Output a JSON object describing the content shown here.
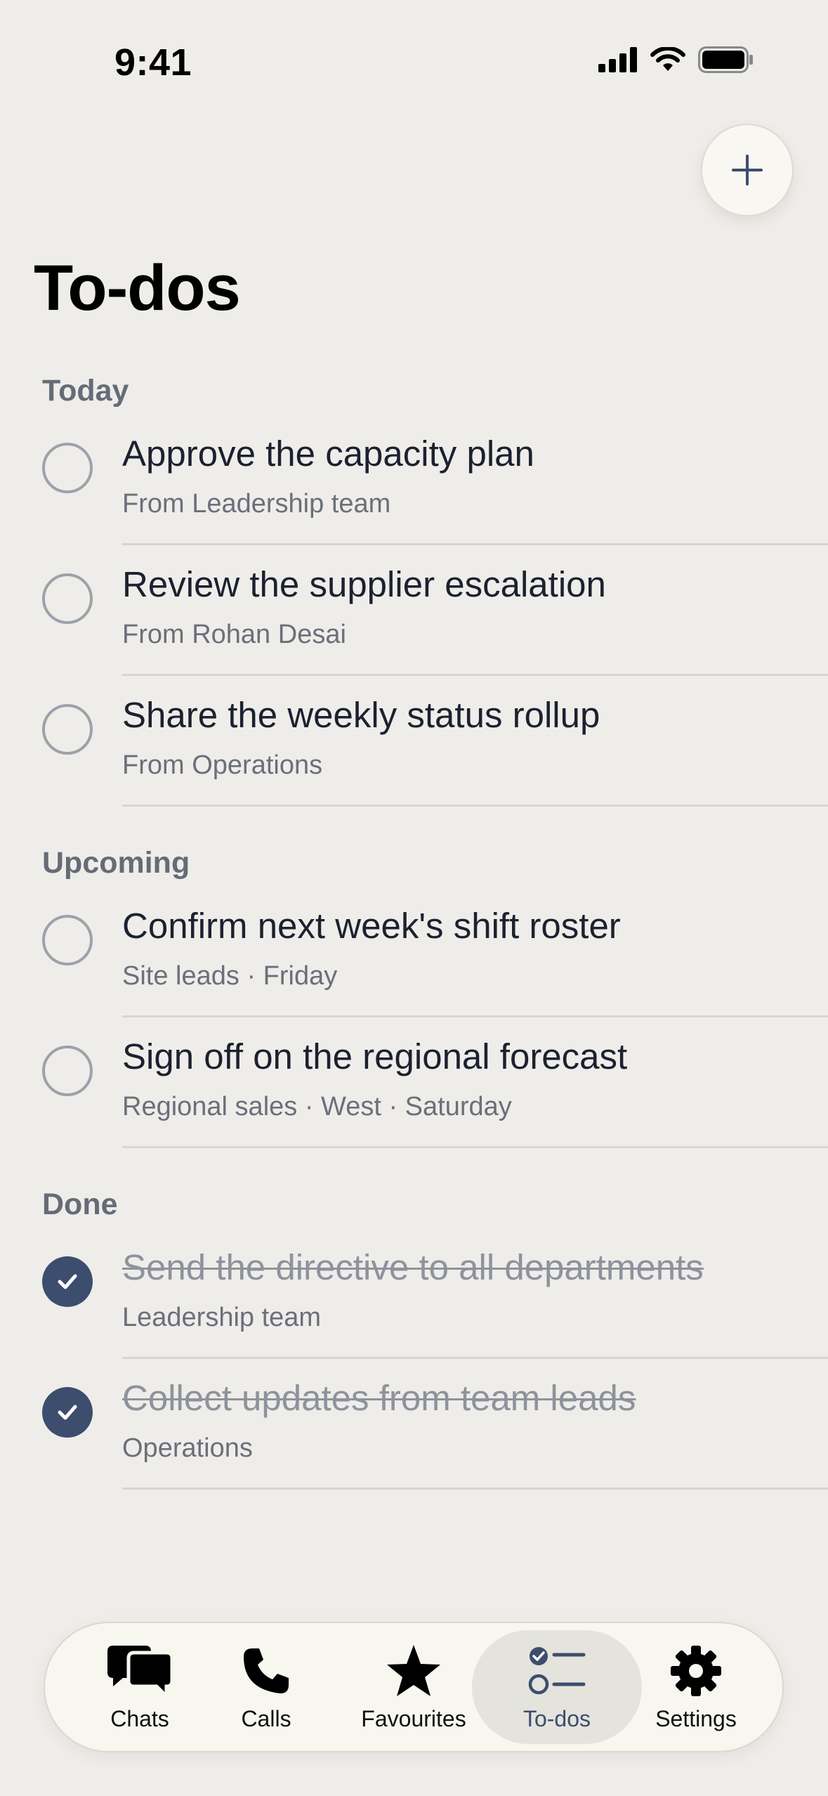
{
  "status_bar": {
    "time": "9:41",
    "icons": [
      "cellular-signal-icon",
      "wifi-icon",
      "battery-icon"
    ]
  },
  "header": {
    "add_icon": "plus-icon",
    "title": "To-dos"
  },
  "sections": [
    {
      "header": "Today",
      "items": [
        {
          "title": "Approve the capacity plan",
          "subtitle": "From Leadership team",
          "done": false
        },
        {
          "title": "Review the supplier escalation",
          "subtitle": "From Rohan Desai",
          "done": false
        },
        {
          "title": "Share the weekly status rollup",
          "subtitle": "From Operations",
          "done": false
        }
      ]
    },
    {
      "header": "Upcoming",
      "items": [
        {
          "title": "Confirm next week's shift roster",
          "subtitle": "Site leads · Friday",
          "done": false
        },
        {
          "title": "Sign off on the regional forecast",
          "subtitle": "Regional sales · West · Saturday",
          "done": false
        }
      ]
    },
    {
      "header": "Done",
      "items": [
        {
          "title": "Send the directive to all departments",
          "subtitle": "Leadership team",
          "done": true
        },
        {
          "title": "Collect updates from team leads",
          "subtitle": "Operations",
          "done": true
        }
      ]
    }
  ],
  "tab_bar": {
    "active": "To-dos",
    "tabs": [
      {
        "label": "Chats",
        "icon": "chat-bubbles-icon"
      },
      {
        "label": "Calls",
        "icon": "phone-icon"
      },
      {
        "label": "Favourites",
        "icon": "star-icon"
      },
      {
        "label": "To-dos",
        "icon": "checklist-icon"
      },
      {
        "label": "Settings",
        "icon": "gear-icon"
      }
    ]
  },
  "colors": {
    "background": "#eeede9",
    "accent": "#3c4d6d",
    "secondary_text": "#6b6f7a",
    "section_header": "#666b78"
  }
}
